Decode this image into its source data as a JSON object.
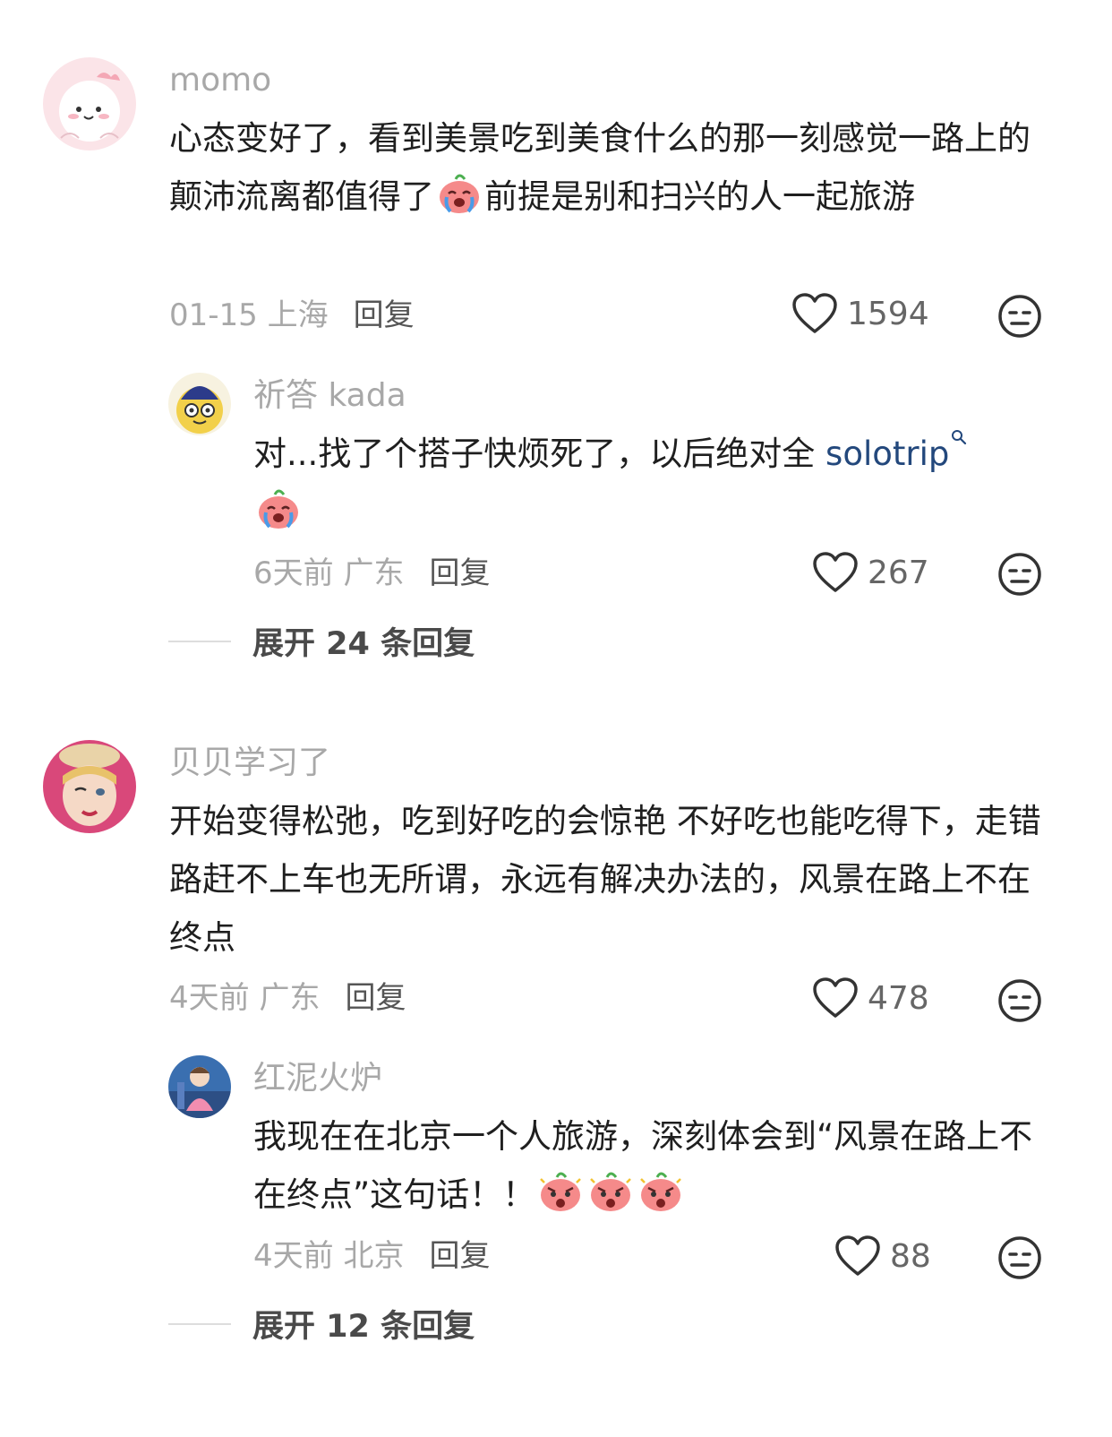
{
  "comments": [
    {
      "user": "momo",
      "text_1": "心态变好了，看到美景吃到美食什么的那一刻感觉一路上的颠沛流离都值得了",
      "text_2": "前提是别和扫兴的人一起旅游",
      "emoji": "crying-face-emoji",
      "time": "01-15 上海",
      "reply_label": "回复",
      "likes": "1594",
      "reply": {
        "user": "祈答 kada",
        "text": "对...找了个搭子快烦死了，以后绝对全 ",
        "link": "solotrip",
        "emoji": "crying-face-emoji",
        "time": "6天前 广东",
        "reply_label": "回复",
        "likes": "267"
      },
      "expand_label": "展开 24 条回复"
    },
    {
      "user": "贝贝学习了",
      "text": "开始变得松弛，吃到好吃的会惊艳 不好吃也能吃得下，走错路赶不上车也无所谓，永远有解决办法的，风景在路上不在终点",
      "time": "4天前 广东",
      "reply_label": "回复",
      "likes": "478",
      "reply": {
        "user": "红泥火炉",
        "text": "我现在在北京一个人旅游，深刻体会到“风景在路上不在终点”这句话！！",
        "emoji": "shocked-face-emoji",
        "time": "4天前 北京",
        "reply_label": "回复",
        "likes": "88"
      },
      "expand_label": "展开 12 条回复"
    }
  ],
  "colors": {
    "username": "#a8a8a8",
    "body": "#1f1f1f",
    "link": "#23487c",
    "meta": "#a8a8a8",
    "reply": "#555555",
    "icon": "#333333"
  },
  "icons": [
    "heart-icon",
    "dislike-face-icon",
    "search-icon"
  ]
}
